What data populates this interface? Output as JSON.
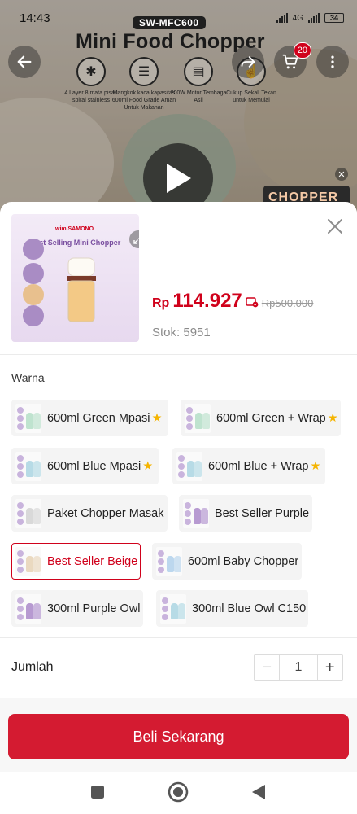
{
  "status_bar": {
    "time": "14:43",
    "network": "4G",
    "battery": "34"
  },
  "media": {
    "model_badge": "SW-MFC600",
    "headline": "Mini Food Chopper",
    "features": [
      {
        "icon": "blade-icon",
        "text": "4 Layer 8 mata pisau spiral stainless"
      },
      {
        "icon": "glass-bowl-icon",
        "text": "Mangkok kaca kapasitas 600ml Food Grade Aman Untuk Makanan"
      },
      {
        "icon": "motor-icon",
        "text": "200W Motor Tembaga Asli"
      },
      {
        "icon": "press-icon",
        "text": "Cukup Sekali Tekan untuk Memulai"
      }
    ],
    "cart_count": "20",
    "promo_text": "CHOPPER"
  },
  "product": {
    "thumb_brand": "wim SAMONO",
    "thumb_title": "Best Selling Mini Chopper",
    "price_currency": "Rp",
    "price": "114.927",
    "original_price": "Rp500.000",
    "stock": "Stok: 5951"
  },
  "variants_label": "Warna",
  "variants": [
    {
      "label": "600ml Green Mpasi",
      "star": true,
      "color": "#bfe3cf",
      "selected": false
    },
    {
      "label": "600ml Green + Wrap",
      "star": true,
      "color": "#bfe3cf",
      "selected": false
    },
    {
      "label": "600ml Blue Mpasi",
      "star": true,
      "color": "#b7dbe6",
      "selected": false
    },
    {
      "label": "600ml Blue + Wrap",
      "star": true,
      "color": "#b7dbe6",
      "selected": false
    },
    {
      "label": "Paket Chopper Masak",
      "star": false,
      "color": "#d9d9d9",
      "selected": false
    },
    {
      "label": "Best Seller Purple",
      "star": false,
      "color": "#b79ad1",
      "selected": false
    },
    {
      "label": "Best Seller Beige",
      "star": false,
      "color": "#ead9c0",
      "selected": true
    },
    {
      "label": "600ml Baby Chopper",
      "star": false,
      "color": "#bcd7ee",
      "selected": false
    },
    {
      "label": "300ml Purple Owl",
      "star": false,
      "color": "#b79ad1",
      "selected": false
    },
    {
      "label": "300ml Blue Owl C150",
      "star": false,
      "color": "#b7dbe6",
      "selected": false
    }
  ],
  "quantity": {
    "label": "Jumlah",
    "value": "1",
    "minus": "−",
    "plus": "+"
  },
  "buy_button": "Beli Sekarang",
  "colors": {
    "accent": "#d0011b",
    "button": "#d41b31"
  }
}
